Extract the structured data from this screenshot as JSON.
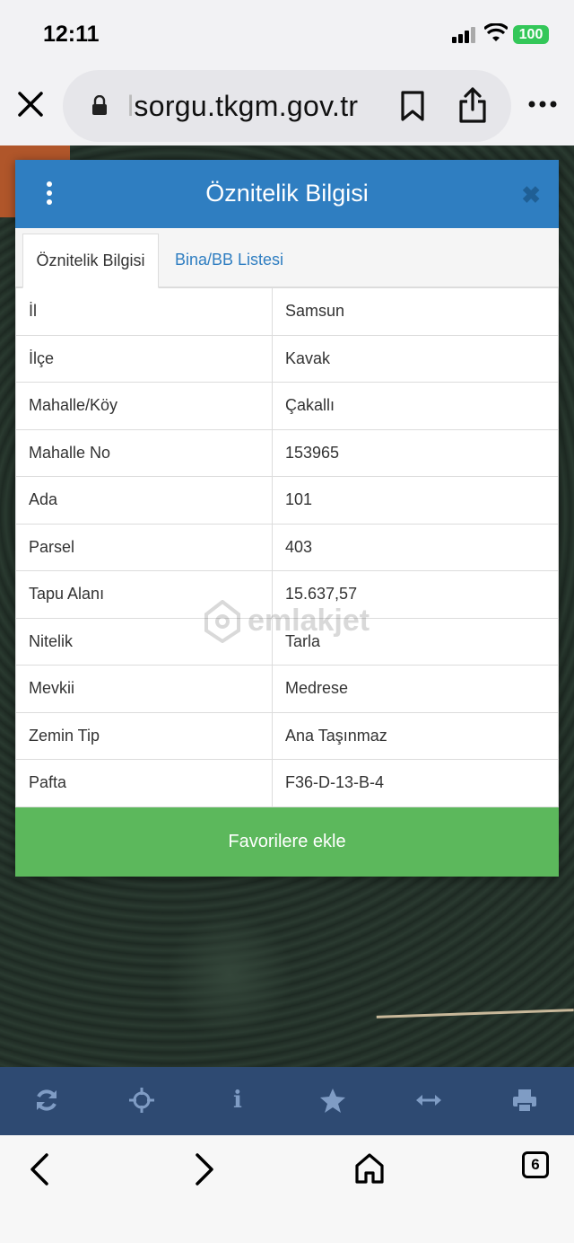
{
  "status": {
    "time": "12:11",
    "battery": "100"
  },
  "browser": {
    "url_faded": "l",
    "url": "sorgu.tkgm.gov.tr"
  },
  "panel": {
    "title": "Öznitelik Bilgisi",
    "close": "✖",
    "tabs": [
      {
        "label": "Öznitelik Bilgisi",
        "active": true
      },
      {
        "label": "Bina/BB Listesi",
        "active": false
      }
    ],
    "rows": [
      {
        "key": "İl",
        "value": "Samsun"
      },
      {
        "key": "İlçe",
        "value": "Kavak"
      },
      {
        "key": "Mahalle/Köy",
        "value": "Çakallı"
      },
      {
        "key": "Mahalle No",
        "value": "153965"
      },
      {
        "key": "Ada",
        "value": "101"
      },
      {
        "key": "Parsel",
        "value": "403"
      },
      {
        "key": "Tapu Alanı",
        "value": "15.637,57"
      },
      {
        "key": "Nitelik",
        "value": "Tarla"
      },
      {
        "key": "Mevkii",
        "value": "Medrese"
      },
      {
        "key": "Zemin Tip",
        "value": "Ana Taşınmaz"
      },
      {
        "key": "Pafta",
        "value": "F36-D-13-B-4"
      }
    ],
    "favorite_button": "Favorilere ekle"
  },
  "watermark": "emlakjet",
  "toolbar": {
    "icons": [
      "refresh-icon",
      "crosshair-icon",
      "info-icon",
      "star-icon",
      "measure-icon",
      "print-icon"
    ],
    "info_glyph": "i"
  },
  "bottom": {
    "tab_count": "6"
  },
  "colors": {
    "header": "#2f7ec1",
    "fav": "#5cb85c",
    "toolbar": "#2e4a72",
    "battery": "#34c759"
  }
}
